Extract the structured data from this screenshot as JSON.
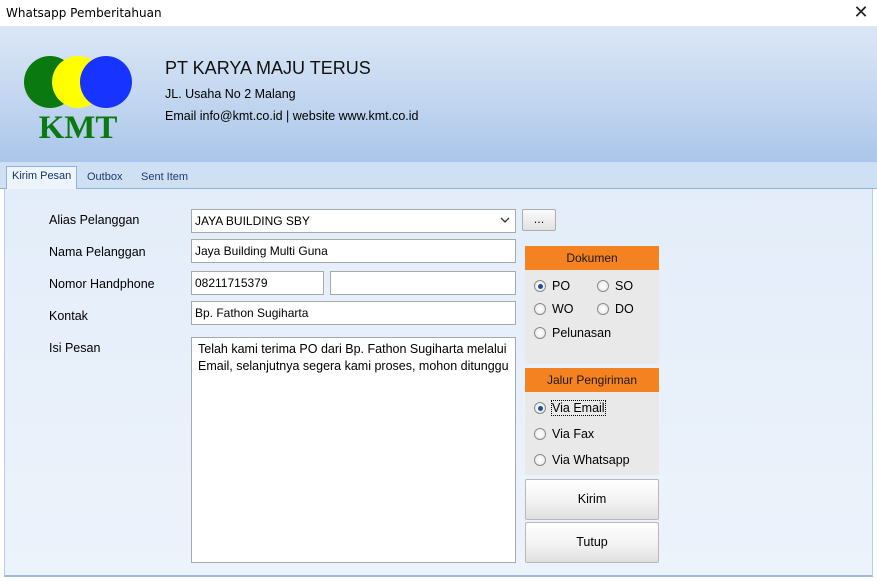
{
  "window": {
    "title": "Whatsapp Pemberitahuan",
    "close_symbol": "✕"
  },
  "header": {
    "logo_text": "KMT",
    "company_name": "PT KARYA MAJU TERUS",
    "address": "JL. Usaha No 2 Malang",
    "contact": "Email info@kmt.co.id | website www.kmt.co.id",
    "colors": {
      "logo_green": "#0a7a10",
      "logo_yellow": "#ffff00",
      "logo_blue": "#1633ff"
    }
  },
  "tabs": [
    {
      "label": "Kirim Pesan",
      "active": true
    },
    {
      "label": "Outbox",
      "active": false
    },
    {
      "label": "Sent Item",
      "active": false
    }
  ],
  "form": {
    "alias_label": "Alias Pelanggan",
    "alias_value": "JAYA BUILDING SBY",
    "browse_label": "...",
    "nama_label": "Nama Pelanggan",
    "nama_value": "Jaya Building Multi Guna",
    "hp_label": "Nomor Handphone",
    "hp_value": "08211715379",
    "hp_value2": "",
    "kontak_label": "Kontak",
    "kontak_value": "Bp. Fathon Sugiharta",
    "pesan_label": "Isi Pesan",
    "pesan_value": "Telah kami terima PO dari Bp. Fathon Sugiharta melalui Email, selanjutnya segera kami proses, mohon ditunggu"
  },
  "dokumen": {
    "title": "Dokumen",
    "options": [
      {
        "label": "PO",
        "selected": true
      },
      {
        "label": "SO",
        "selected": false
      },
      {
        "label": "WO",
        "selected": false
      },
      {
        "label": "DO",
        "selected": false
      },
      {
        "label": "Pelunasan",
        "selected": false
      }
    ]
  },
  "jalur": {
    "title": "Jalur Pengiriman",
    "options": [
      {
        "label": "Via Email",
        "selected": true
      },
      {
        "label": "Via Fax",
        "selected": false
      },
      {
        "label": "Via Whatsapp",
        "selected": false
      }
    ]
  },
  "buttons": {
    "kirim": "Kirim",
    "tutup": "Tutup"
  },
  "colors": {
    "group_header": "#f58220",
    "header_gradient_bottom": "#aac6ea"
  }
}
